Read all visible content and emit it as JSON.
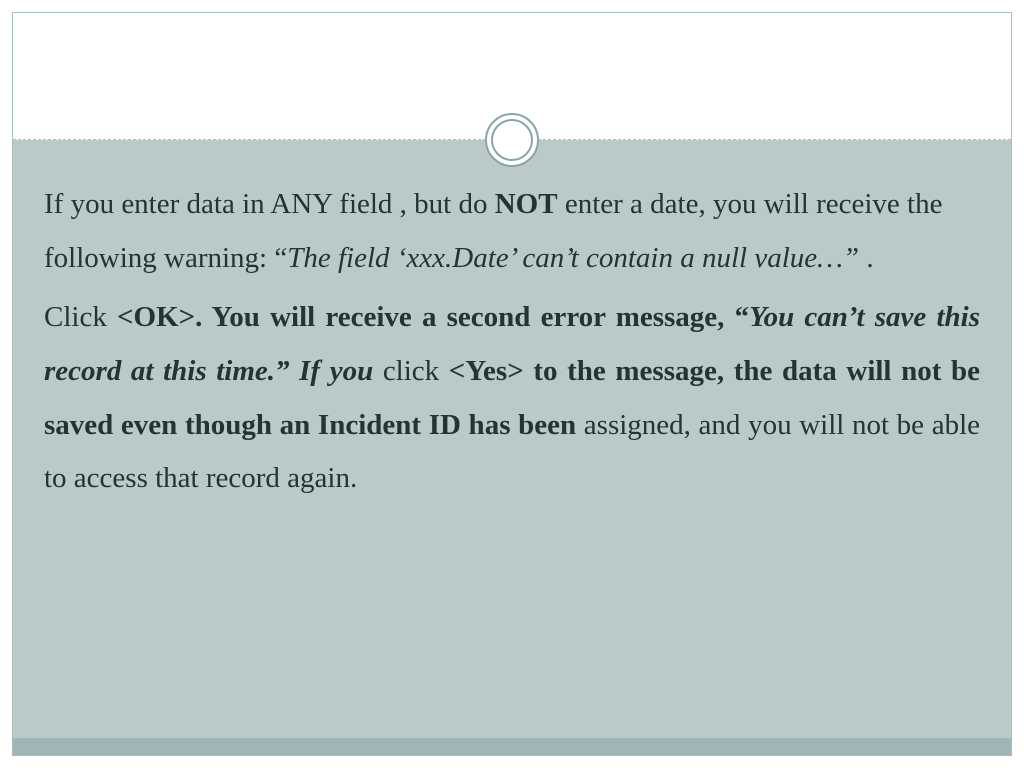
{
  "para1": {
    "t1": "If you enter data in ANY field , but do ",
    "not": "NOT",
    "t2": " enter a date, you will receive the following warning: “",
    "quote": "The field ‘xxx.Date’ can’t contain a null value…”",
    "t3": " ."
  },
  "para2": {
    "t1": "Click ",
    "b1": "<OK>. You will receive a second error message, “",
    "i1": "You can’t save this record at this time.” If you ",
    "t2": "click ",
    "b2": "<Yes> to the message, the data will not be saved even though an Incident ID has been ",
    "t3": "assigned, and you will not be able to access that record again."
  }
}
